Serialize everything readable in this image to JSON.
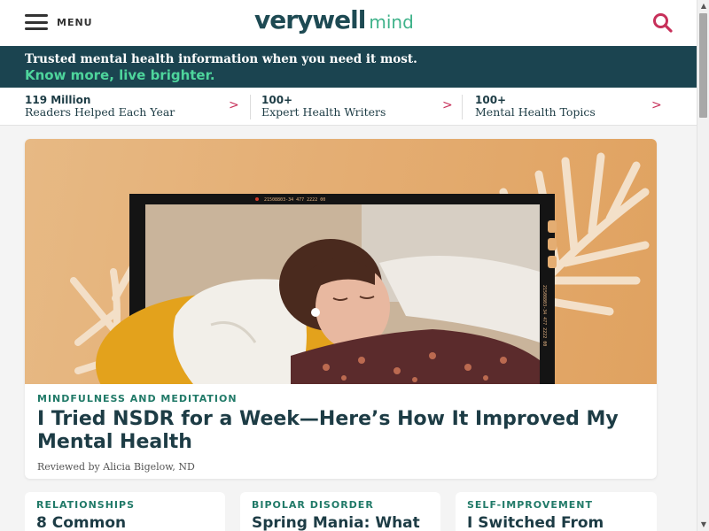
{
  "header": {
    "menu_label": "MENU",
    "logo_main": "verywell",
    "logo_sub": "mind"
  },
  "banner": {
    "line1": "Trusted mental health information when you need it most.",
    "line2": "Know more, live brighter."
  },
  "stats": [
    {
      "number": "119 Million",
      "label": "Readers Helped Each Year"
    },
    {
      "number": "100+",
      "label": "Expert Health Writers"
    },
    {
      "number": "100+",
      "label": "Mental Health Topics"
    }
  ],
  "stat_chevron": ">",
  "hero": {
    "kicker": "MINDFULNESS AND MEDITATION",
    "title": "I Tried NSDR for a Week—Here’s How It Improved My Mental Health",
    "byline": "Reviewed by Alicia Bigelow, ND",
    "film_text_top": "21508803-34 477    2222 00",
    "film_text_side": "21508803-34 477    2222 00"
  },
  "cards": [
    {
      "kicker": "RELATIONSHIPS",
      "title": "8 Common"
    },
    {
      "kicker": "BIPOLAR DISORDER",
      "title": "Spring Mania: What"
    },
    {
      "kicker": "SELF-IMPROVEMENT",
      "title": "I Switched From"
    }
  ],
  "icons": {
    "menu": "hamburger-icon",
    "search": "search-icon",
    "chevron": "chevron-right-icon"
  },
  "colors": {
    "brand_dark": "#1b4450",
    "brand_green": "#3fb28a",
    "accent": "#c7305a",
    "kicker": "#217a68"
  }
}
